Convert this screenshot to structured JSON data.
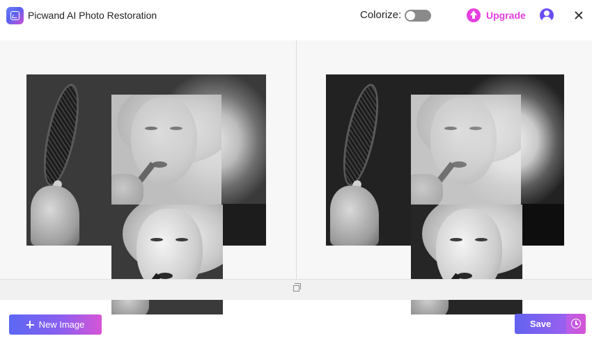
{
  "app": {
    "title": "Picwand AI Photo Restoration",
    "logo_icon": "photo-frame-icon"
  },
  "header": {
    "colorize_label": "Colorize:",
    "colorize_enabled": false,
    "upgrade_label": "Upgrade",
    "upgrade_icon": "arrow-up-circle-icon",
    "account_icon": "user-circle-icon",
    "close_icon": "close-icon"
  },
  "panels": {
    "left": {
      "role": "original-image"
    },
    "right": {
      "role": "restored-image"
    }
  },
  "footer": {
    "new_image_label": "New Image",
    "new_image_icon": "plus-icon",
    "save_label": "Save",
    "history_icon": "clock-icon"
  },
  "colors": {
    "accent_blue": "#5b68f3",
    "accent_purple": "#8a5ff0",
    "accent_pink": "#e03fdc",
    "account_violet": "#6a4df2"
  }
}
